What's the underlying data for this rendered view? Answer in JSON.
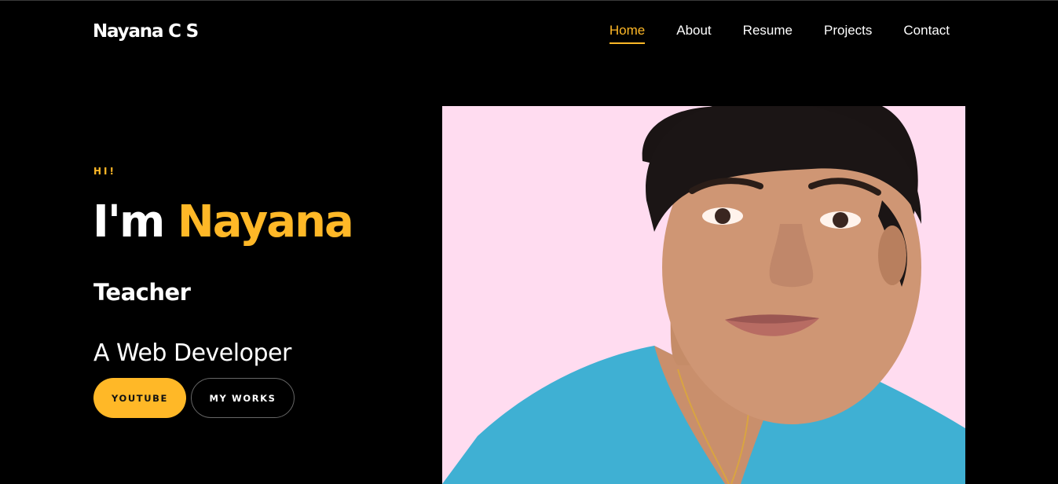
{
  "header": {
    "logo": "Nayana C S",
    "nav": [
      {
        "label": "Home",
        "active": true
      },
      {
        "label": "About",
        "active": false
      },
      {
        "label": "Resume",
        "active": false
      },
      {
        "label": "Projects",
        "active": false
      },
      {
        "label": "Contact",
        "active": false
      }
    ]
  },
  "hero": {
    "greeting": "HI!",
    "intro": "I'm",
    "name": "Nayana",
    "role": "Teacher",
    "subrole": "A Web Developer",
    "buttons": {
      "youtube": "YOUTUBE",
      "works": "MY WORKS"
    }
  },
  "colors": {
    "accent": "#ffb827",
    "background": "#000000",
    "photo_background": "#ffdcf0"
  }
}
